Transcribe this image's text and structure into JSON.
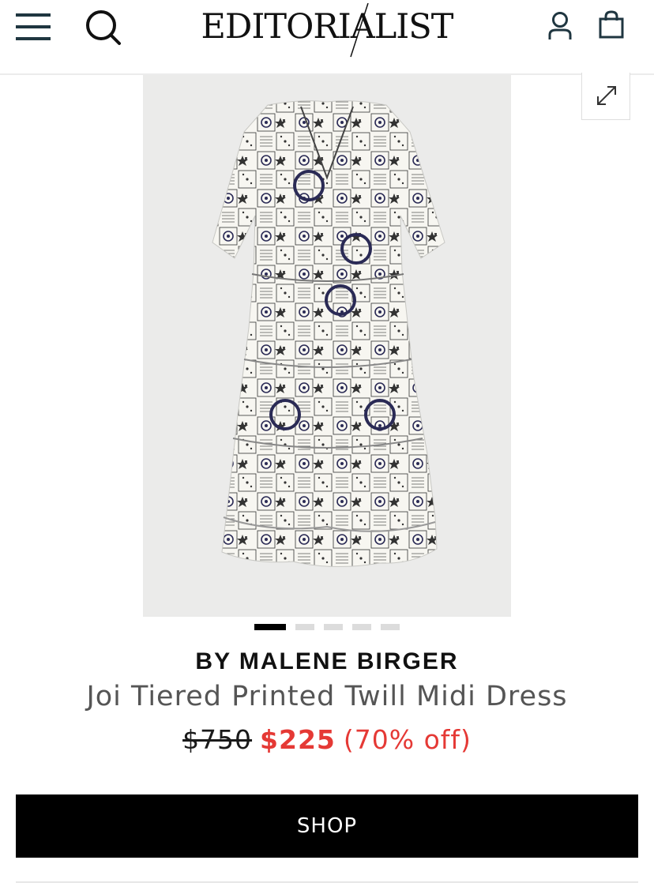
{
  "header": {
    "logo_text": "EDITORIALIST",
    "icons": {
      "menu": "hamburger-menu-icon",
      "search": "search-icon",
      "account": "account-icon",
      "bag": "shopping-bag-icon"
    }
  },
  "gallery": {
    "image_count": 5,
    "active_index": 0,
    "expand_icon": "expand-icon"
  },
  "product": {
    "brand": "BY MALENE BIRGER",
    "name": "Joi Tiered Printed Twill Midi Dress",
    "original_price": "$750",
    "sale_price": "$225",
    "discount": "(70% off)"
  },
  "cta": {
    "shop_label": "SHOP"
  },
  "colors": {
    "sale": "#e53935",
    "header_icon": "#1f3640",
    "button_bg": "#000000"
  }
}
